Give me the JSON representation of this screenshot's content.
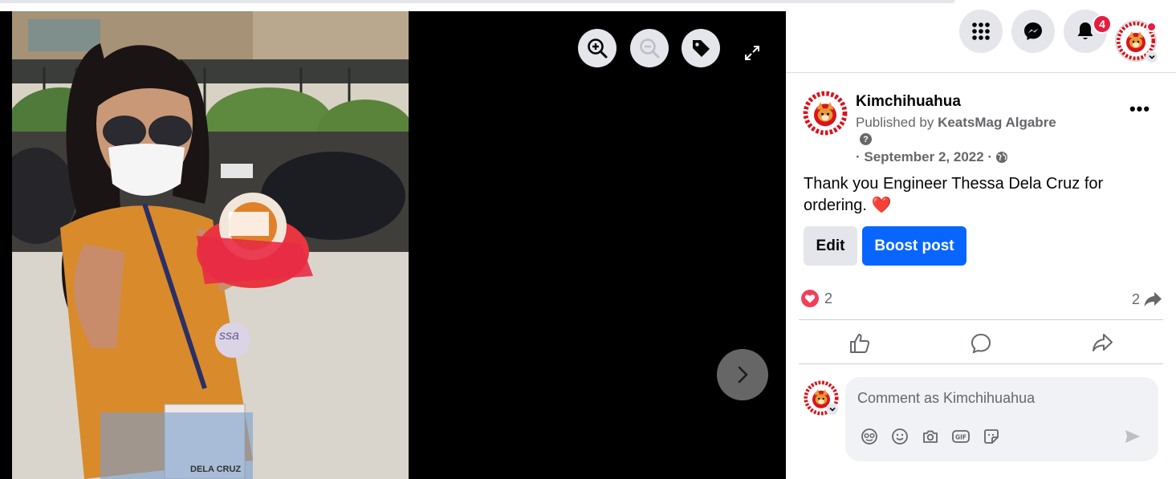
{
  "viewer": {
    "zoom_in_icon": "zoom-in-icon",
    "zoom_out_icon": "zoom-out-icon",
    "tag_icon": "tag-icon",
    "expand_icon": "expand-icon",
    "next_icon": "chevron-right-icon",
    "photo_badge_top": "ssa",
    "photo_id_text": "DELA CRUZ"
  },
  "topnav": {
    "menu_icon": "grid-menu-icon",
    "messenger_icon": "messenger-icon",
    "notifications_icon": "bell-icon",
    "notification_count": "4"
  },
  "post": {
    "page_name": "Kimchihuahua",
    "published_by_prefix": "Published by ",
    "publisher": "KeatsMag Algabre",
    "help_glyph": "?",
    "date": "· September 2, 2022 ·",
    "audience_icon": "globe-icon",
    "more_label": "•••",
    "text": "Thank you Engineer Thessa Dela Cruz for ordering. ❤️",
    "edit_label": "Edit",
    "boost_label": "Boost post",
    "reaction_count": "2",
    "share_count": "2",
    "like_icon": "like-icon",
    "comment_icon": "comment-icon",
    "share_icon": "share-icon"
  },
  "comment": {
    "placeholder": "Comment as Kimchihuahua",
    "icons": [
      "avatar-sticker-icon",
      "emoji-icon",
      "camera-icon",
      "gif-icon",
      "sticker-icon"
    ],
    "send_icon": "send-icon"
  },
  "colors": {
    "accent": "#0866ff",
    "badge": "#e41e3f",
    "muted": "#65676b",
    "button_bg": "#e4e6eb"
  }
}
